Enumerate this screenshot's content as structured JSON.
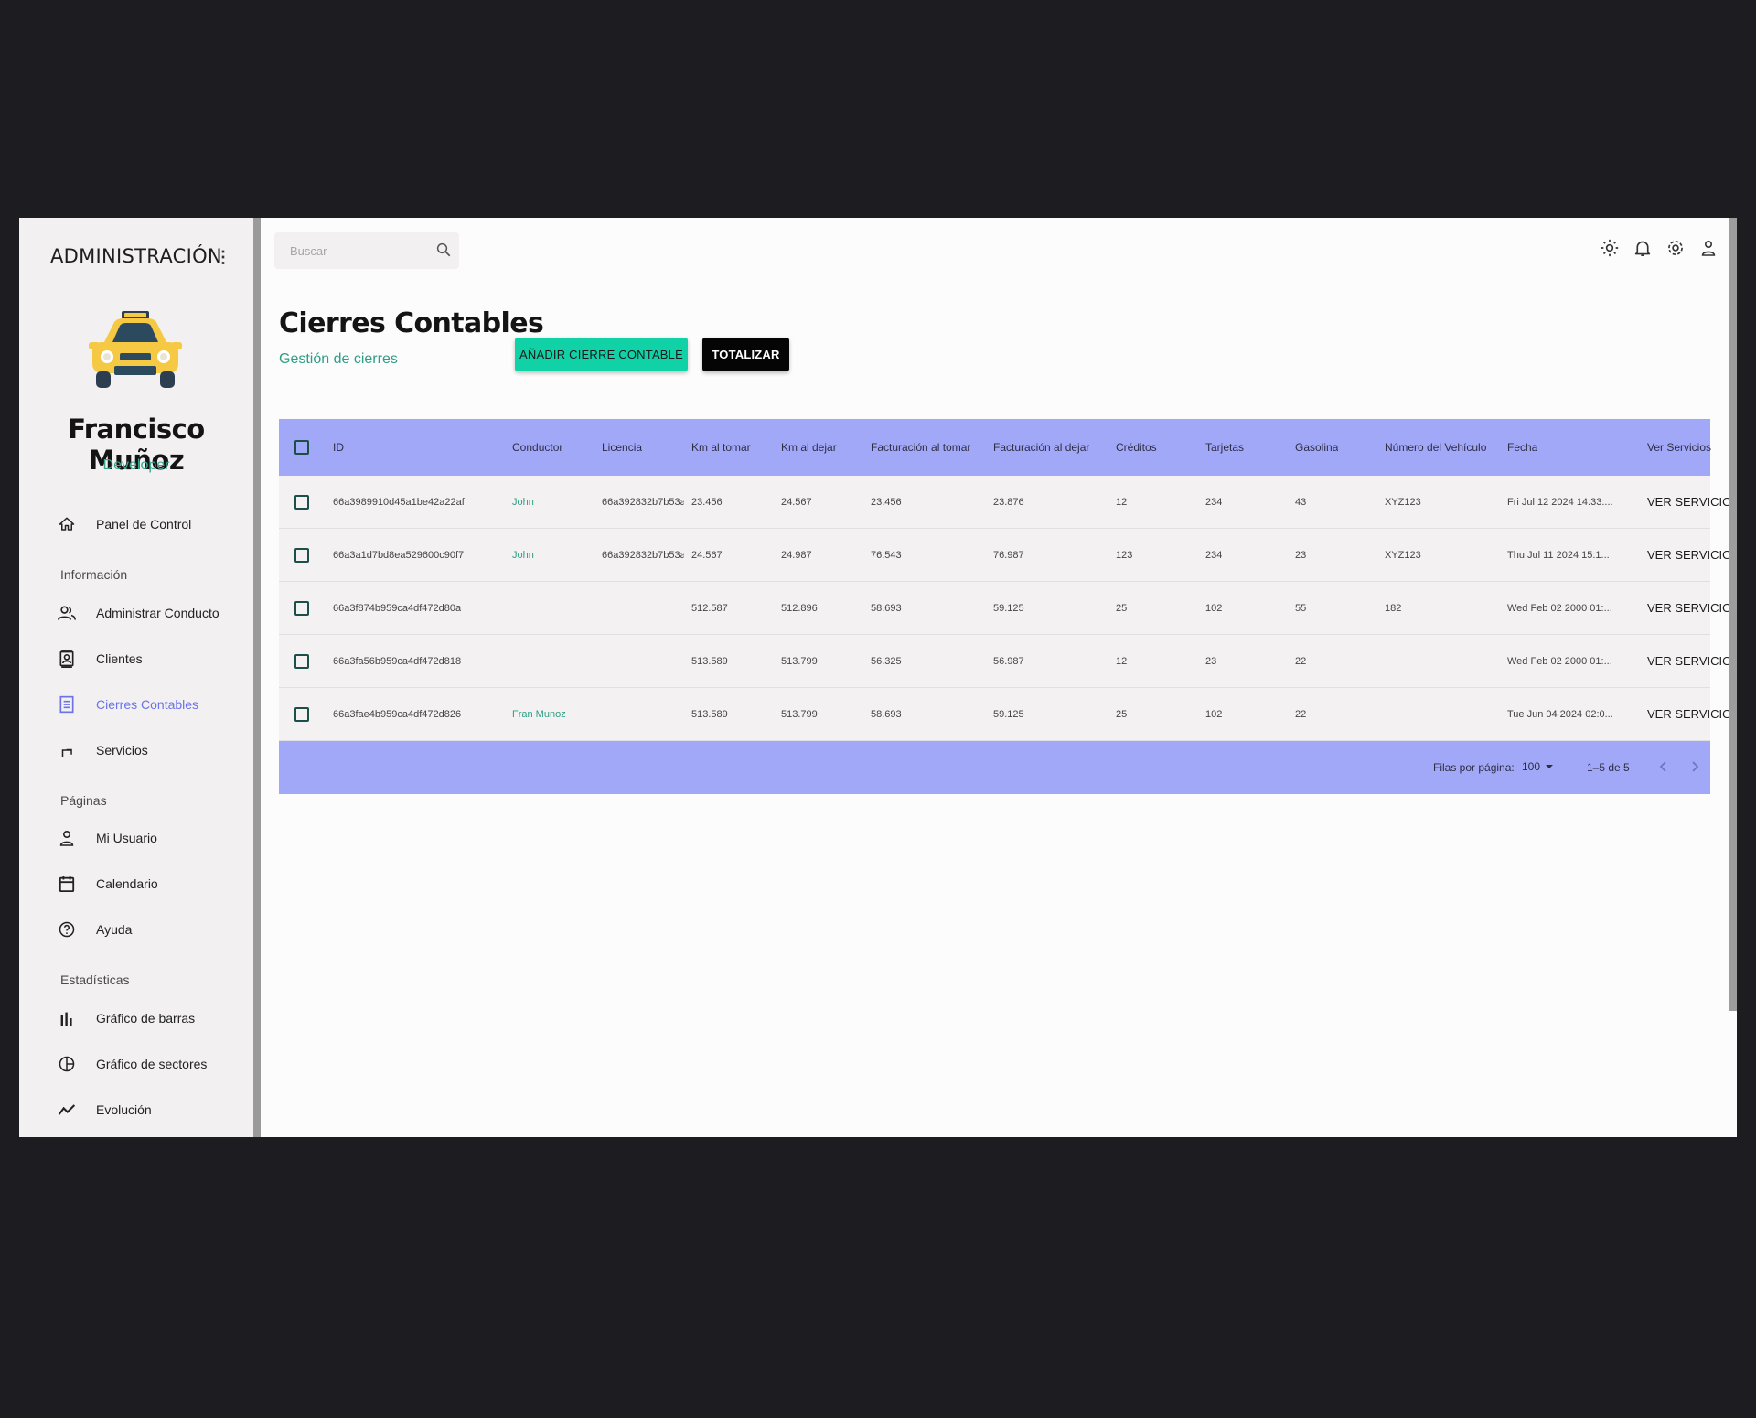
{
  "sidebar": {
    "title": "ADMINISTRACIÓN",
    "menu_glyph": "⋮",
    "user_name": "Francisco Muñoz",
    "user_role": "Developer",
    "items": [
      {
        "label": "Panel de Control",
        "icon": "home-icon"
      },
      {
        "label": "Administrar Conductores",
        "icon": "people-icon"
      },
      {
        "label": "Clientes",
        "icon": "contacts-icon"
      },
      {
        "label": "Cierres Contables",
        "icon": "receipt-icon",
        "active": true
      },
      {
        "label": "Servicios",
        "icon": "turn-icon"
      },
      {
        "label": "Mi Usuario",
        "icon": "person-icon"
      },
      {
        "label": "Calendario",
        "icon": "calendar-icon"
      },
      {
        "label": "Ayuda",
        "icon": "help-icon"
      },
      {
        "label": "Gráfico de barras",
        "icon": "bar-chart-icon"
      },
      {
        "label": "Gráfico de sectores",
        "icon": "pie-chart-icon"
      },
      {
        "label": "Evolución",
        "icon": "timeline-icon"
      }
    ],
    "sections": [
      "Información",
      "Páginas",
      "Estadísticas"
    ]
  },
  "topbar": {
    "search_placeholder": "Buscar",
    "icons": [
      "light-mode-icon",
      "notifications-icon",
      "settings-icon",
      "person-icon"
    ]
  },
  "page": {
    "title": "Cierres Contables",
    "subtitle": "Gestión de cierres",
    "add_button": "AÑADIR CIERRE CONTABLE",
    "total_button": "TOTALIZAR"
  },
  "table": {
    "headers": [
      "ID",
      "Conductor",
      "Licencia",
      "Km al tomar",
      "Km al dejar",
      "Facturación al tomar",
      "Facturación al dejar",
      "Créditos",
      "Tarjetas",
      "Gasolina",
      "Número del Vehículo",
      "Fecha",
      "Ver Servicios"
    ],
    "rows": [
      [
        "66a3989910d45a1be42a22af",
        "John",
        "66a392832b7b53a",
        "23.456",
        "24.567",
        "23.456",
        "23.876",
        "12",
        "234",
        "43",
        "XYZ123",
        "Fri Jul 12 2024 14:33:...",
        "VER SERVICIOS"
      ],
      [
        "66a3a1d7bd8ea529600c90f7",
        "John",
        "66a392832b7b53a",
        "24.567",
        "24.987",
        "76.543",
        "76.987",
        "123",
        "234",
        "23",
        "XYZ123",
        "Thu Jul 11 2024 15:1...",
        "VER SERVICIOS"
      ],
      [
        "66a3f874b959ca4df472d80a",
        "",
        "",
        "512.587",
        "512.896",
        "58.693",
        "59.125",
        "25",
        "102",
        "55",
        "182",
        "Wed Feb 02 2000 01:...",
        "VER SERVICIOS"
      ],
      [
        "66a3fa56b959ca4df472d818",
        "",
        "",
        "513.589",
        "513.799",
        "56.325",
        "56.987",
        "12",
        "23",
        "22",
        "",
        "Wed Feb 02 2000 01:...",
        "VER SERVICIOS"
      ],
      [
        "66a3fae4b959ca4df472d826",
        "Fran Munoz",
        "",
        "513.589",
        "513.799",
        "58.693",
        "59.125",
        "25",
        "102",
        "22",
        "",
        "Tue Jun 04 2024 02:0...",
        "VER SERVICIOS"
      ]
    ],
    "footer": {
      "rows_per_page_label": "Filas por página:",
      "rows_per_page_value": "100",
      "range": "1–5 de 5"
    }
  },
  "colors": {
    "accent": "#11d1a7",
    "table_header": "#a2a8f8",
    "active_nav": "#6b73e8",
    "teal_text": "#2f9e86"
  }
}
